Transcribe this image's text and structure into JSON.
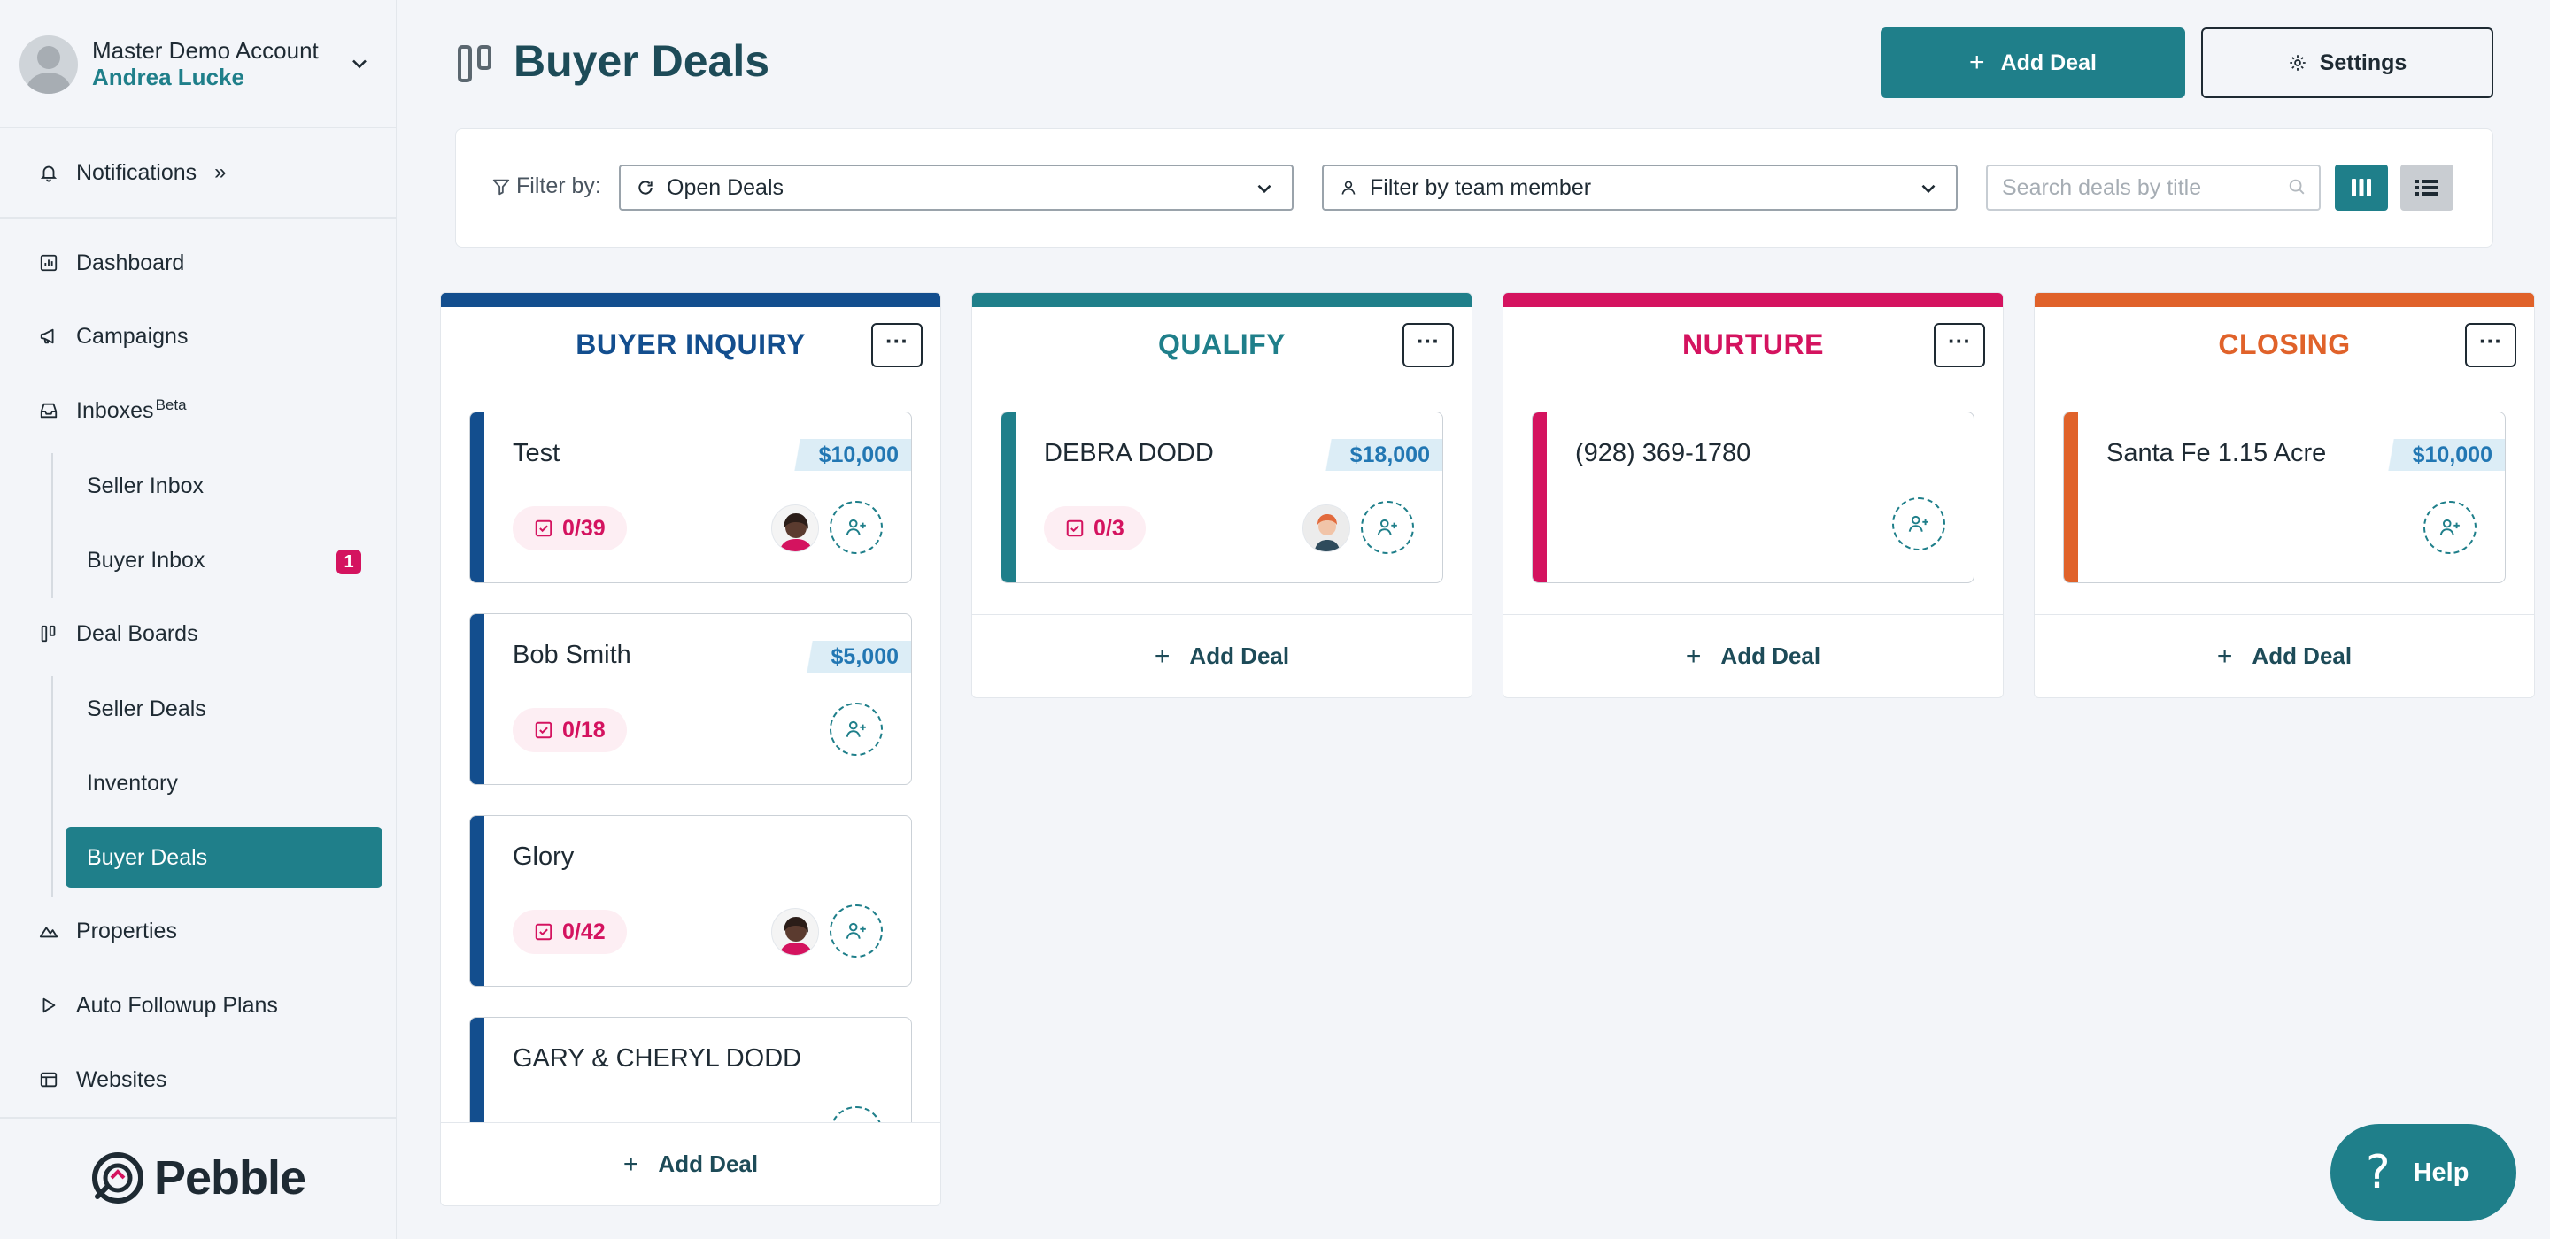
{
  "account": {
    "name": "Master Demo Account",
    "user": "Andrea Lucke"
  },
  "sidebar": {
    "notifications": "Notifications",
    "dashboard": "Dashboard",
    "campaigns": "Campaigns",
    "inboxes": "Inboxes",
    "inboxes_badge": "Beta",
    "seller_inbox": "Seller Inbox",
    "buyer_inbox": "Buyer Inbox",
    "buyer_inbox_count": "1",
    "deal_boards": "Deal Boards",
    "seller_deals": "Seller Deals",
    "inventory": "Inventory",
    "buyer_deals": "Buyer Deals",
    "properties": "Properties",
    "auto_followup": "Auto Followup Plans",
    "websites": "Websites"
  },
  "brand": {
    "name": "Pebble"
  },
  "header": {
    "title": "Buyer Deals",
    "add_deal": "Add Deal",
    "settings": "Settings"
  },
  "filters": {
    "label": "Filter by:",
    "status": "Open Deals",
    "member": "Filter by team member",
    "search_placeholder": "Search deals by title"
  },
  "columns": [
    {
      "title": "BUYER INQUIRY",
      "color": "#134e8e",
      "footer": "Add Deal",
      "cards": [
        {
          "title": "Test",
          "price": "$10,000",
          "tasks": "0/39",
          "member": true
        },
        {
          "title": "Bob Smith",
          "price": "$5,000",
          "tasks": "0/18",
          "member": false
        },
        {
          "title": "Glory",
          "price": "",
          "tasks": "0/42",
          "member": true
        },
        {
          "title": "GARY & CHERYL DODD",
          "price": "",
          "tasks": "",
          "member": false
        }
      ]
    },
    {
      "title": "QUALIFY",
      "color": "#1f7f8a",
      "footer": "Add Deal",
      "cards": [
        {
          "title": "DEBRA DODD",
          "price": "$18,000",
          "tasks": "0/3",
          "member": true
        }
      ]
    },
    {
      "title": "NURTURE",
      "color": "#d4135f",
      "footer": "Add Deal",
      "cards": [
        {
          "title": "(928) 369-1780",
          "price": "",
          "tasks": "",
          "member": false
        }
      ]
    },
    {
      "title": "CLOSING",
      "color": "#e0622a",
      "footer": "Add Deal",
      "cards": [
        {
          "title": "Santa Fe 1.15 Acre",
          "price": "$10,000",
          "tasks": "",
          "member": false
        }
      ]
    }
  ],
  "help": {
    "label": "Help"
  },
  "colors": {
    "accent": "#1f7f8a",
    "title": "#1d4b58",
    "danger": "#d4135f",
    "price": "#2277b3"
  }
}
